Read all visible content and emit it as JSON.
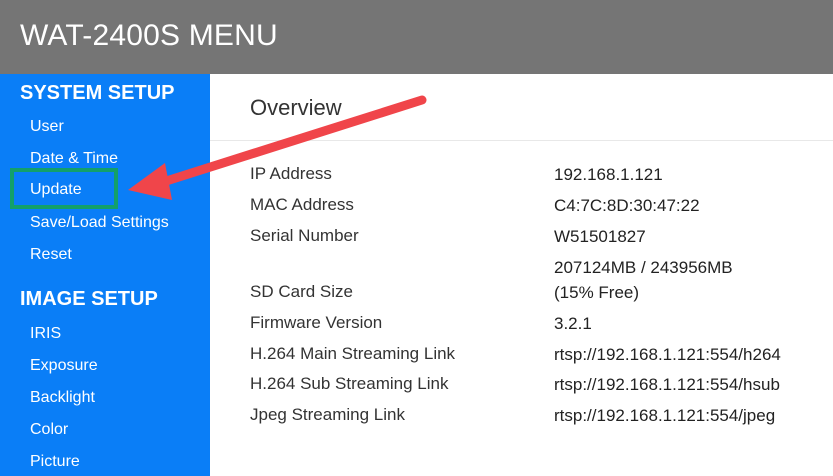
{
  "header": {
    "title": "WAT-2400S MENU"
  },
  "sidebar": {
    "system_setup_title": "SYSTEM SETUP",
    "system_items": [
      "User",
      "Date & Time",
      "Update",
      "Save/Load Settings",
      "Reset"
    ],
    "image_setup_title": "IMAGE SETUP",
    "image_items": [
      "IRIS",
      "Exposure",
      "Backlight",
      "Color",
      "Picture"
    ]
  },
  "overview": {
    "title": "Overview",
    "rows": [
      {
        "label": "IP Address",
        "value": "192.168.1.121"
      },
      {
        "label": "MAC Address",
        "value": "C4:7C:8D:30:47:22"
      },
      {
        "label": "Serial Number",
        "value": "W51501827"
      },
      {
        "label": "SD Card Size",
        "value_line1": "207124MB / 243956MB",
        "value_line2": "(15% Free)"
      },
      {
        "label": "Firmware Version",
        "value": "3.2.1"
      },
      {
        "label": "H.264 Main Streaming Link",
        "value": "rtsp://192.168.1.121:554/h264"
      },
      {
        "label": "H.264 Sub Streaming Link",
        "value": "rtsp://192.168.1.121:554/hsub"
      },
      {
        "label": "Jpeg Streaming Link",
        "value": "rtsp://192.168.1.121:554/jpeg"
      }
    ]
  },
  "annotation": {
    "highlight_color": "#13a06b",
    "arrow_color": "#f0454a"
  }
}
